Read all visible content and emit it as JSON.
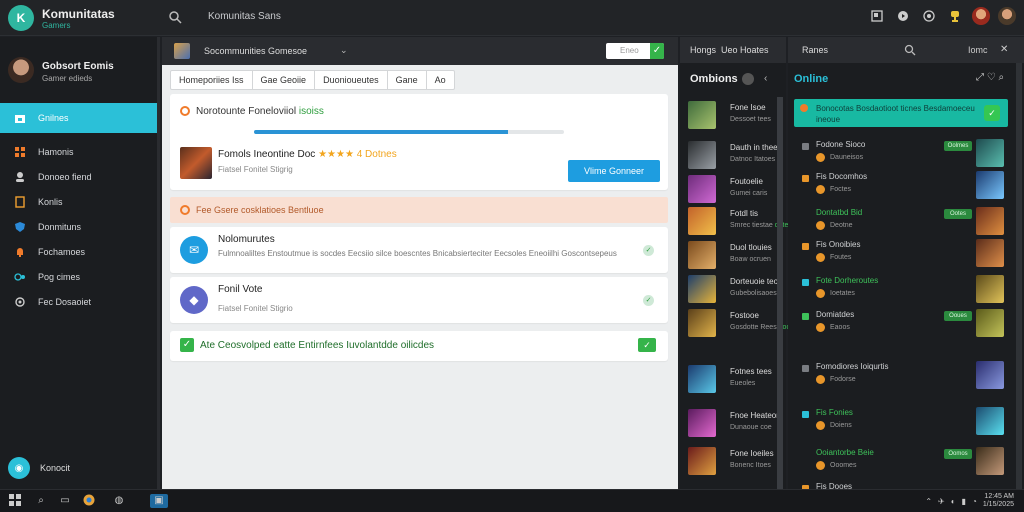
{
  "topbar": {
    "logo_glyph": "K",
    "brand_title": "Komunitatas",
    "brand_sub": "Gamers",
    "search_text": "Komunitas Sans",
    "icons": [
      "window-icon",
      "video-icon",
      "chat-icon",
      "trophy-icon",
      "user-avatar"
    ]
  },
  "sidebar": {
    "profile": {
      "name": "Gobsort Eomis",
      "sub": "Gamer edieds"
    },
    "items": [
      {
        "label": "Gnilnes",
        "icon": "home-icon"
      },
      {
        "label": "Hamonis",
        "icon": "grid-icon"
      },
      {
        "label": "Donoeo fiend",
        "icon": "users-icon"
      },
      {
        "label": "Konlis",
        "icon": "bookmark-icon"
      },
      {
        "label": "Donmituns",
        "icon": "shield-icon"
      },
      {
        "label": "Fochamoes",
        "icon": "bell-icon"
      },
      {
        "label": "Pog cimes",
        "icon": "gamepad-icon"
      },
      {
        "label": "Fec Dosaoiet",
        "icon": "gear-icon"
      }
    ],
    "footer_label": "Konocit"
  },
  "main": {
    "header": {
      "text": "Socommunities Gomesoe",
      "input_placeholder": "Eneo",
      "check_glyph": "✓"
    },
    "tabs": [
      "Homeporiies Iss",
      "Gae Geoiie",
      "Duonioueutes",
      "Gane",
      "Ao"
    ],
    "card1": {
      "title_prefix": "Norotounte Foneloviiol",
      "title_highlight": "isoiss",
      "progress": 0.82,
      "game_name": "Fomols Ineontine Doc",
      "stars": "★★★★ 4",
      "game_tag": "Dotnes",
      "meta": "Fiatsel Fonitel Stigrig",
      "button": "Vlime Gonneer"
    },
    "banner": "Fee Gsere cosklatioes Bentluoe",
    "items": [
      {
        "title": "Nolomurutes",
        "desc": "Fulmnoaliltes Enstoutmue is socdes Eecsiio silce boescntes Bnicabsierteciter Eecsoles Eneoiilhi Goscontsepeus",
        "icon": "chat-icon"
      },
      {
        "title": "Fonil Vote",
        "desc": "Fiatsel Fonitel Stigrio",
        "icon": "cube-icon"
      }
    ],
    "confirm_text": "Ate Ceosvolped eatte Entirnfees Iuvolantdde oilicdes"
  },
  "games": {
    "header_a": "Hongs",
    "header_b": "Ueo Hoates",
    "title": "Ombions",
    "list": [
      {
        "name": "Fone Isoe",
        "sub": "Dessoet tees",
        "hl": "",
        "thumb": [
          "#3f6b3c",
          "#a9c46e"
        ]
      },
      {
        "name": "Dauth in thees",
        "sub": "Datnoc Itatoes",
        "hl": "",
        "thumb": [
          "#2a2d30",
          "#9aa0a6"
        ]
      },
      {
        "name": "Foutoelie",
        "sub": "Gumei caris",
        "hl": "",
        "thumb": [
          "#6e2c7b",
          "#d06ad4"
        ]
      },
      {
        "name": "Fotdl tis",
        "sub": "Smrec tiestae",
        "hl": "dutes",
        "thumb": [
          "#c2622a",
          "#f2c04a"
        ]
      },
      {
        "name": "Duol tlouies",
        "sub": "Boaw ocruen",
        "hl": "",
        "thumb": [
          "#7a4a1d",
          "#e4b06a"
        ]
      },
      {
        "name": "Dorteuoie teon",
        "sub": "Gubebolisaoes",
        "hl": "",
        "thumb": [
          "#1d3e6b",
          "#e7b43a"
        ]
      },
      {
        "name": "Fostooe",
        "sub": "Gosdotte Rees",
        "hl": "eoo",
        "thumb": [
          "#5a3f1a",
          "#e2b44a"
        ]
      },
      {
        "name": "Fotnes tees",
        "sub": "Eueoles",
        "hl": "",
        "thumb": [
          "#1b3a6e",
          "#5ac8e8"
        ]
      },
      {
        "name": "Fnoe Heateon",
        "sub": "Dunaoue coe",
        "hl": "",
        "thumb": [
          "#5a1b5e",
          "#e46ad0"
        ]
      },
      {
        "name": "Fone Ioeiles",
        "sub": "Bonenc Itoes",
        "hl": "",
        "thumb": [
          "#6a1b1b",
          "#e0a040"
        ]
      }
    ]
  },
  "online": {
    "header_text": "Ranes",
    "header_label": "Iomc",
    "title": "Online",
    "alert": "Bonocotas Bosdaotioot ticnes Besdamoeceu ineoue",
    "friends": [
      {
        "name": "Fodone Sioco",
        "sub": "Dauneisos",
        "name_class": "gray",
        "badge": "#7a7d82",
        "tag": "Oolmes",
        "thumb": [
          "#1e4a4e",
          "#5abfb0"
        ]
      },
      {
        "name": "Fis Docomhos",
        "sub": "Foctes",
        "name_class": "gray",
        "badge": "#e8962a",
        "tag": "",
        "thumb": [
          "#1b3a6e",
          "#7ac8ff"
        ]
      },
      {
        "name": "Dontatbd Bid",
        "sub": "Deotne",
        "name_class": "green",
        "badge": "",
        "tag": "Ootes",
        "thumb": [
          "#6a2d1b",
          "#e09040"
        ]
      },
      {
        "name": "Fis Onoibies",
        "sub": "Foutes",
        "name_class": "gray",
        "badge": "#e8962a",
        "tag": "",
        "thumb": [
          "#5a2c1a",
          "#e0904a"
        ]
      },
      {
        "name": "Fote Dorheroutes",
        "sub": "Ioetates",
        "name_class": "green",
        "badge": "#2bc0d8",
        "tag": "",
        "thumb": [
          "#5a4a1a",
          "#e2c45a"
        ]
      },
      {
        "name": "Domiatdes",
        "sub": "Eaoos",
        "name_class": "gray",
        "badge": "#3ec25a",
        "tag": "Ooues",
        "thumb": [
          "#5a5a1a",
          "#c4c45a"
        ]
      },
      {
        "name": "Fomodiores Ioiqurtis",
        "sub": "Fodorse",
        "name_class": "gray",
        "badge": "#7a7d82",
        "tag": "",
        "thumb": [
          "#2a2d6e",
          "#8a9ae0"
        ]
      },
      {
        "name": "Fis Fonies",
        "sub": "Doiens",
        "name_class": "green",
        "badge": "#2bc0d8",
        "tag": "",
        "thumb": [
          "#1b4a6e",
          "#5ae0f0"
        ]
      },
      {
        "name": "Ooiantorbe Beie",
        "sub": "Ooomes",
        "name_class": "green",
        "badge": "",
        "tag": "Oomos",
        "thumb": [
          "#3a2c1a",
          "#c49a7a"
        ]
      },
      {
        "name": "Fis Dooes",
        "sub": "",
        "name_class": "gray",
        "badge": "#e8962a",
        "tag": "",
        "thumb": [
          "#1b1d20",
          "#1b1d20"
        ]
      }
    ]
  },
  "taskbar": {
    "time": "12:45 AM",
    "date": "1/15/2025"
  }
}
